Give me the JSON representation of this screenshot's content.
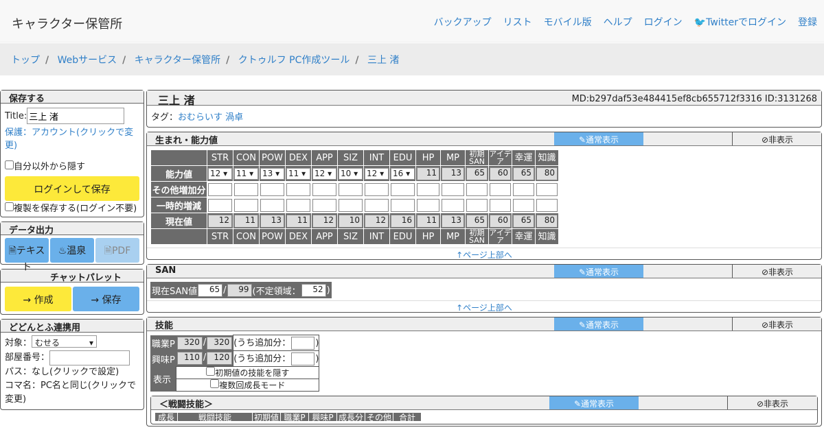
{
  "nav": {
    "brand": "キャラクター保管所",
    "links": [
      "バックアップ",
      "リスト",
      "モバイル版",
      "ヘルプ",
      "ログイン",
      "Twitterでログイン",
      "登録"
    ]
  },
  "crumbs": [
    "トップ",
    "Webサービス",
    "キャラクター保管所",
    "クトゥルフ PC作成ツール",
    "三上 渚"
  ],
  "save": {
    "title": "保存する",
    "title_label": "Title:",
    "title_value": "三上 渚",
    "protect": "保護：アカウント(クリックで変更)",
    "hide_label": "自分以外から隠す",
    "login_save": "ログインして保存",
    "copy_label": "複製を保存する(ログイン不要)"
  },
  "export": {
    "title": "データ出力",
    "text": "テキスト",
    "onsen": "温泉",
    "pdf": "PDF"
  },
  "palette": {
    "title": "チャットパレット",
    "create": "→ 作成",
    "save": "→ 保存"
  },
  "dodon": {
    "title": "どどんとふ連携用",
    "target_label": "対象：",
    "target_value": "むせる",
    "room_label": "部屋番号：",
    "pass": "パス：なし(クリックで設定)",
    "koma": "コマ名：PC名と同じ(クリックで変更)"
  },
  "char": {
    "name": "三上 渚",
    "md": "MD:b297daf53e484415ef8cb655712f3316",
    "id": "ID:3131268",
    "tag_label": "タグ：",
    "tags": "おむらいす 渦卓"
  },
  "sections": {
    "stats": "生まれ・能力値",
    "san": "SAN",
    "skills": "技能",
    "combat": "＜戦闘技能＞",
    "normal": "✎通常表示",
    "hide": "⊘非表示",
    "top": "↑ページ上部へ"
  },
  "stats": {
    "headers": [
      "STR",
      "CON",
      "POW",
      "DEX",
      "APP",
      "SIZ",
      "INT",
      "EDU",
      "HP",
      "MP",
      "初期SAN",
      "アイデア",
      "幸運",
      "知識"
    ],
    "rows": [
      "能力値",
      "その他増加分",
      "一時的増減",
      "現在値"
    ],
    "base": [
      "12",
      "11",
      "13",
      "11",
      "12",
      "10",
      "12",
      "16",
      "11",
      "13",
      "65",
      "60",
      "65",
      "80"
    ],
    "current": [
      "12",
      "11",
      "13",
      "11",
      "12",
      "10",
      "12",
      "16",
      "11",
      "13",
      "65",
      "60",
      "65",
      "80"
    ]
  },
  "san": {
    "label": "現在SAN値",
    "cur": "65",
    "max": "99",
    "indef_label": "(不定領域：",
    "indef": "52"
  },
  "skills": {
    "job_label": "職業P",
    "job_cur": "320",
    "job_max": "320",
    "hobby_label": "興味P",
    "hobby_cur": "110",
    "hobby_max": "120",
    "add_label": "(うち追加分：",
    "disp_label": "表示",
    "opt1": "初期値の技能を隠す",
    "opt2": "複数回成長モード",
    "combat_cols": [
      "成長",
      "戦闘技能",
      "初期値",
      "職業P",
      "興味P",
      "成長分",
      "その他",
      "合計"
    ]
  }
}
